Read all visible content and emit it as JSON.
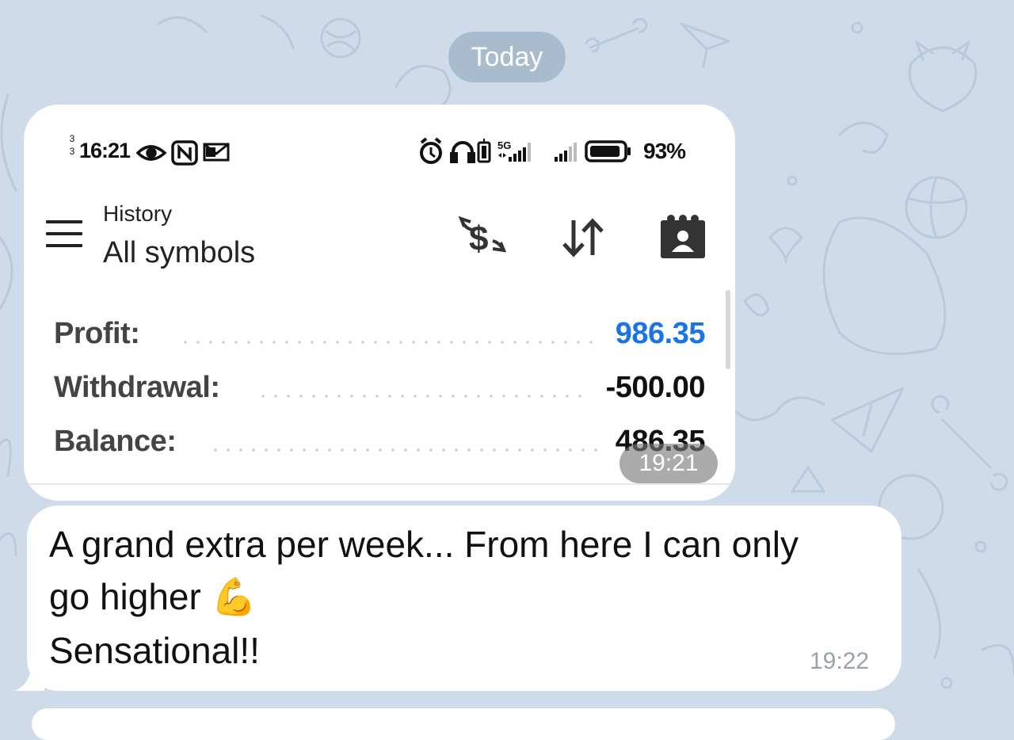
{
  "date_separator": "Today",
  "screenshot": {
    "status_bar": {
      "tiny_top": "3",
      "tiny_bottom": "3",
      "time": "16:21",
      "left_icons": [
        "eye-icon",
        "nfc-icon",
        "notification-icon"
      ],
      "right_icons": [
        "alarm-icon",
        "headphones-icon",
        "vibrate-icon",
        "signal-5g-icon",
        "signal-icon",
        "battery-icon"
      ],
      "network_label": "5G",
      "battery_text": "93%",
      "battery_level": 0.93
    },
    "app_bar": {
      "title": "History",
      "subtitle": "All symbols",
      "actions": [
        "dollar-exchange-icon",
        "sort-icon",
        "calendar-icon"
      ]
    },
    "summary": [
      {
        "label": "Profit:",
        "value": "986.35",
        "color": "#1a73e8"
      },
      {
        "label": "Withdrawal:",
        "value": "-500.00",
        "color": "#111111"
      },
      {
        "label": "Balance:",
        "value": "486.35",
        "color": "#111111"
      }
    ],
    "timestamp": "19:21"
  },
  "message": {
    "line1": "A grand extra per week... From here I can only",
    "line2": "go higher",
    "emoji": "💪",
    "line3": "Sensational!!",
    "timestamp": "19:22"
  },
  "colors": {
    "background": "#cfdbe8",
    "date_pill": "#a8bccd",
    "profit_blue": "#1a73e8"
  }
}
